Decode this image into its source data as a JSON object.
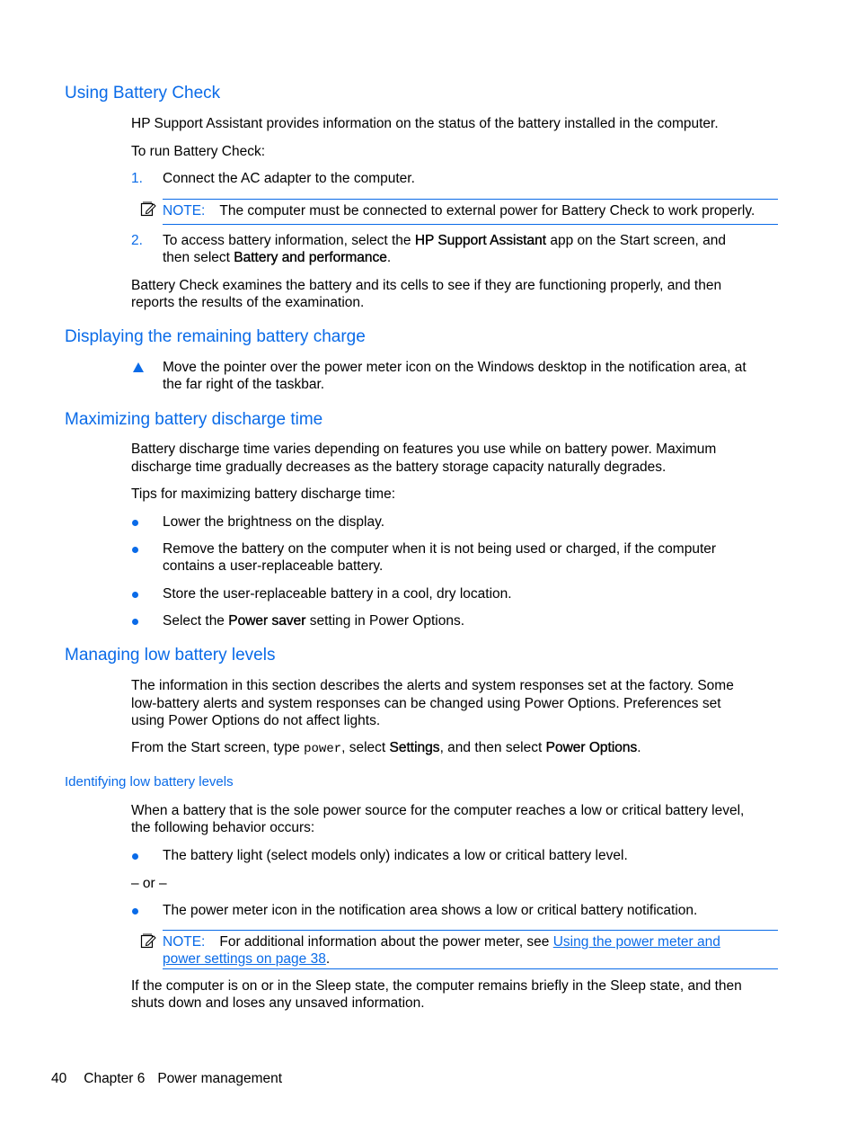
{
  "sections": {
    "battery_check": {
      "heading": "Using Battery Check",
      "intro": "HP Support Assistant provides information on the status of the battery installed in the computer.",
      "lead": "To run Battery Check:",
      "steps": [
        {
          "number": "1.",
          "text": "Connect the AC adapter to the computer."
        },
        {
          "number": "2.",
          "line1_pre": "To access battery information, select the ",
          "line1_bold": "HP Support Assistant",
          "line1_post": " app on the Start screen, and",
          "line2_pre": "then select ",
          "line2_bold": "Battery and performance",
          "line2_post": "."
        }
      ],
      "note": {
        "label": "NOTE:",
        "text": "The computer must be connected to external power for Battery Check to work properly."
      },
      "outro_line1": "Battery Check examines the battery and its cells to see if they are functioning properly, and then",
      "outro_line2": "reports the results of the examination."
    },
    "remaining_charge": {
      "heading": "Displaying the remaining battery charge",
      "step_line1": "Move the pointer over the power meter icon on the Windows desktop in the notification area, at",
      "step_line2": "the far right of the taskbar."
    },
    "discharge_time": {
      "heading": "Maximizing battery discharge time",
      "intro_line1": "Battery discharge time varies depending on features you use while on battery power. Maximum",
      "intro_line2": "discharge time gradually decreases as the battery storage capacity naturally degrades.",
      "lead": "Tips for maximizing battery discharge time:",
      "tips": [
        {
          "text": "Lower the brightness on the display."
        },
        {
          "line1": "Remove the battery on the computer when it is not being used or charged, if the computer",
          "line2": "contains a user-replaceable battery."
        },
        {
          "text": "Store the user-replaceable battery in a cool, dry location."
        },
        {
          "pre": "Select the ",
          "bold": "Power saver",
          "post": " setting in Power Options."
        }
      ]
    },
    "low_battery": {
      "heading": "Managing low battery levels",
      "intro_line1": "The information in this section describes the alerts and system responses set at the factory. Some",
      "intro_line2": "low-battery alerts and system responses can be changed using Power Options. Preferences set",
      "intro_line3": "using Power Options do not affect lights.",
      "instruction": {
        "pre": "From the Start screen, type ",
        "code": "power",
        "mid1": ", select ",
        "bold1": "Settings",
        "mid2": ", and then select ",
        "bold2": "Power Options",
        "post": "."
      },
      "subsection": {
        "heading": "Identifying low battery levels",
        "intro_line1": "When a battery that is the sole power source for the computer reaches a low or critical battery level,",
        "intro_line2": "the following behavior occurs:",
        "bullet1": "The battery light (select models only) indicates a low or critical battery level.",
        "or_text": "– or –",
        "bullet2": "The power meter icon in the notification area shows a low or critical battery notification.",
        "note": {
          "label": "NOTE:",
          "text_pre": "For additional information about the power meter, see ",
          "link_line1": "Using the power meter and",
          "link_line2": "power settings on page 38",
          "text_post": "."
        },
        "outro_line1": "If the computer is on or in the Sleep state, the computer remains briefly in the Sleep state, and then",
        "outro_line2": "shuts down and loses any unsaved information."
      }
    }
  },
  "footer": {
    "page_number": "40",
    "chapter": "Chapter 6",
    "chapter_title": "Power management"
  },
  "colors": {
    "accent": "#0a6be8",
    "text": "#000000"
  }
}
